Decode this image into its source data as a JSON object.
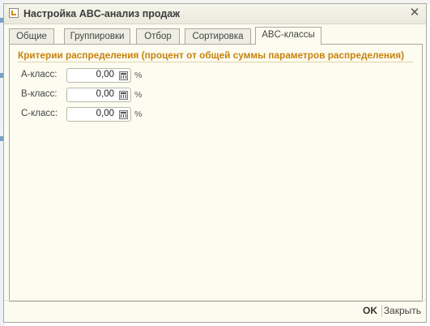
{
  "window": {
    "title": "Настройка ABC-анализ продаж",
    "close_glyph": "✕"
  },
  "tabs": [
    {
      "label": "Общие"
    },
    {
      "label": "Группировки"
    },
    {
      "label": "Отбор"
    },
    {
      "label": "Сортировка"
    },
    {
      "label": "ABC-классы",
      "active": true
    }
  ],
  "section": {
    "title": "Критерии распределения (процент от общей суммы параметров распределения)"
  },
  "classes": [
    {
      "label": "А-класс:",
      "value": "0,00",
      "unit": "%"
    },
    {
      "label": "B-класс:",
      "value": "0,00",
      "unit": "%"
    },
    {
      "label": "C-класс:",
      "value": "0,00",
      "unit": "%"
    }
  ],
  "footer": {
    "ok_label": "OK",
    "close_label": "Закрыть"
  },
  "icons": {
    "window": "report-icon",
    "calculator": "calculator-icon"
  },
  "colors": {
    "accent": "#c8820e",
    "window_bg": "#fbfbef"
  }
}
